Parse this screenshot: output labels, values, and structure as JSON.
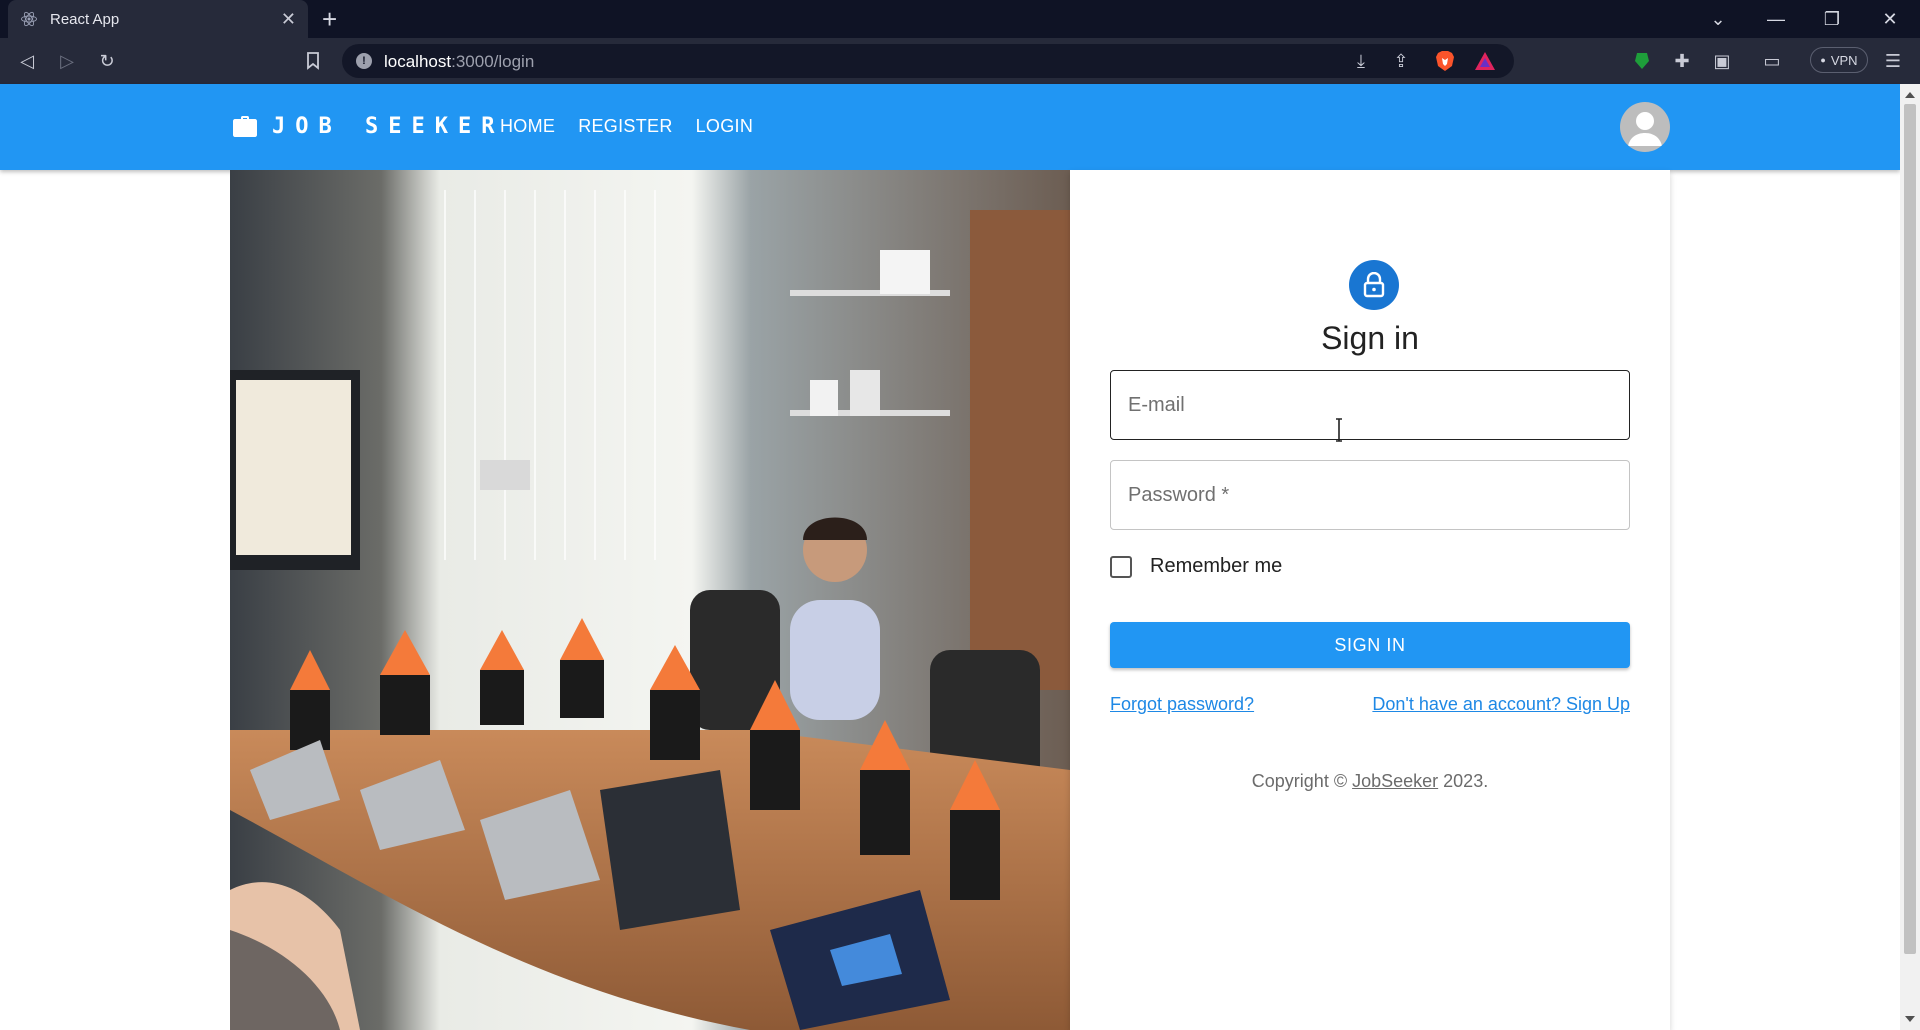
{
  "browser": {
    "tab_title": "React App",
    "url_host": "localhost",
    "url_rest": ":3000/login",
    "vpn_label": "VPN"
  },
  "app": {
    "brand": "JOB SEEKER",
    "nav": [
      {
        "label": "HOME"
      },
      {
        "label": "REGISTER"
      },
      {
        "label": "LOGIN"
      }
    ],
    "colors": {
      "primary": "#2196f3",
      "lock_avatar": "#1976d2",
      "link": "#1e88e5"
    }
  },
  "login": {
    "title": "Sign in",
    "email_placeholder": "E-mail",
    "password_placeholder": "Password *",
    "remember_label": "Remember me",
    "submit_label": "SIGN IN",
    "forgot_link": "Forgot password?",
    "signup_link": "Don't have an account? Sign Up"
  },
  "footer": {
    "prefix": "Copyright © ",
    "brand_link": "JobSeeker",
    "suffix": " 2023."
  },
  "icons": [
    "react-icon",
    "close-icon",
    "plus-icon",
    "back-icon",
    "forward-icon",
    "reload-icon",
    "bookmark-icon",
    "info-icon",
    "download-icon",
    "share-icon",
    "brave-icon",
    "rewards-icon",
    "extension-icon",
    "puzzle-icon",
    "sidebar-icon",
    "wallet-icon",
    "menu-icon",
    "briefcase-icon",
    "person-icon",
    "lock-icon"
  ]
}
